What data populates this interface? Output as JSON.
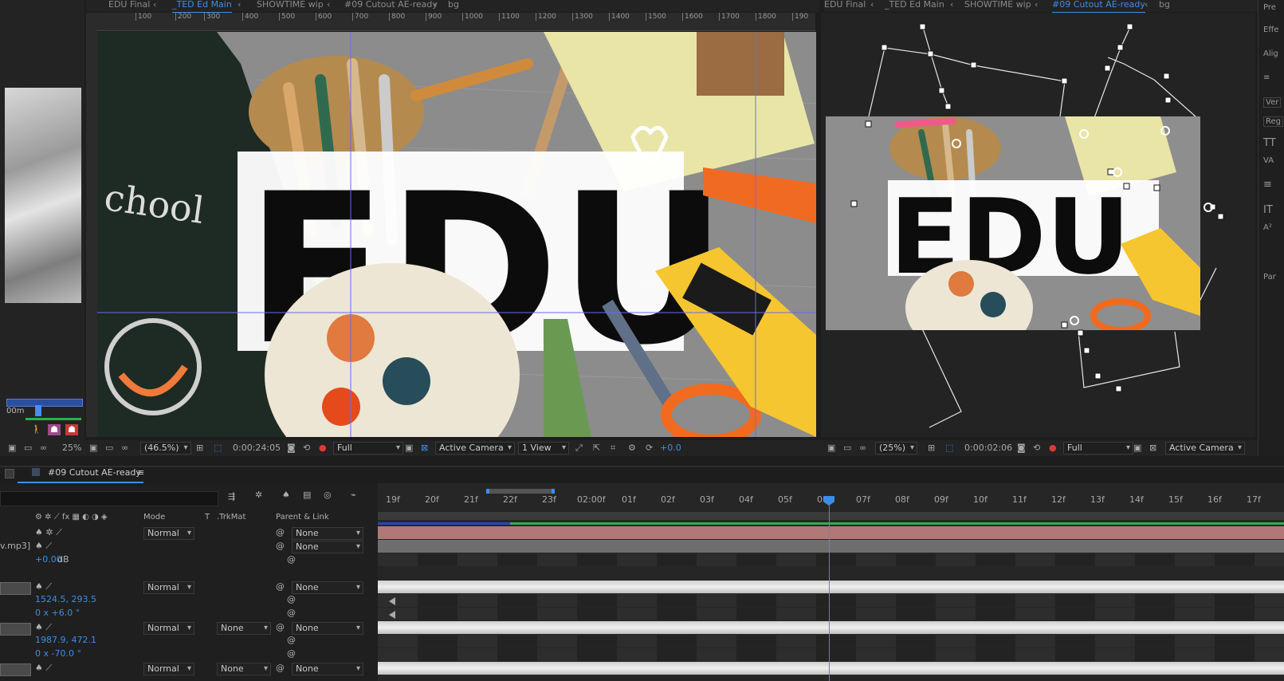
{
  "main_tabs": [
    {
      "label": "EDU Final",
      "active": false
    },
    {
      "label": "_TED Ed Main",
      "active": true
    },
    {
      "label": "SHOWTIME wip",
      "active": false
    },
    {
      "label": "#09 Cutout AE-ready",
      "active": false
    },
    {
      "label": "bg",
      "active": false
    }
  ],
  "right_tabs": [
    {
      "label": "EDU Final",
      "active": false
    },
    {
      "label": "_TED Ed Main",
      "active": false
    },
    {
      "label": "SHOWTIME wip",
      "active": false
    },
    {
      "label": "#09 Cutout AE-ready",
      "active": true
    },
    {
      "label": "bg",
      "active": false
    }
  ],
  "ruler_ticks": [
    "100",
    "200",
    "300",
    "400",
    "500",
    "600",
    "700",
    "800",
    "900",
    "1000",
    "1100",
    "1200",
    "1300",
    "1400",
    "1500",
    "1600",
    "1700",
    "1800",
    "190"
  ],
  "canvas_text": {
    "edu": "EDU",
    "chalk": "chool"
  },
  "left_mini": {
    "time_label": "00m"
  },
  "main_bar": {
    "zoom_left": "25%",
    "magnification": "(46.5%)",
    "timecode": "0:00:24:05",
    "resolution": "Full",
    "camera": "Active Camera",
    "views": "1 View",
    "exposure": "+0.0"
  },
  "right_bar": {
    "magnification": "(25%)",
    "timecode": "0:00:02:06",
    "resolution": "Full",
    "camera": "Active Camera"
  },
  "right_panel": [
    "Pre",
    "Effe",
    "Alig",
    "Ver",
    "Reg",
    "Par"
  ],
  "timeline": {
    "comp_tab": "#09 Cutout AE-ready",
    "columns": {
      "mode": "Mode",
      "t": "T",
      "trkmat": ".TrkMat",
      "parent": "Parent & Link"
    },
    "ruler": [
      "19f",
      "20f",
      "21f",
      "22f",
      "23f",
      "02:00f",
      "01f",
      "02f",
      "03f",
      "04f",
      "05f",
      "06f",
      "07f",
      "08f",
      "09f",
      "10f",
      "11f",
      "12f",
      "13f",
      "14f",
      "15f",
      "16f",
      "17f"
    ],
    "audio_layer_suffix": "v.mp3]",
    "audio_level": "+0.00",
    "audio_unit": "dB",
    "layers": [
      {
        "mode": "Normal",
        "trkmat": "",
        "parent": "None"
      },
      {
        "mode": "",
        "trkmat": "",
        "parent": "None"
      },
      {
        "mode": "Normal",
        "trkmat": "",
        "parent": "None",
        "position": "1524.5, 293.5",
        "rotation": "0 x +6.0 °"
      },
      {
        "mode": "Normal",
        "trkmat": "None",
        "parent": "None",
        "position": "1987.9, 472.1",
        "rotation": "0 x -70.0 °"
      },
      {
        "mode": "Normal",
        "trkmat": "None",
        "parent": "None"
      }
    ]
  },
  "colors": {
    "accent": "#3d8ee8",
    "green_bar": "#27b34b",
    "audio_track": "#b27777"
  }
}
